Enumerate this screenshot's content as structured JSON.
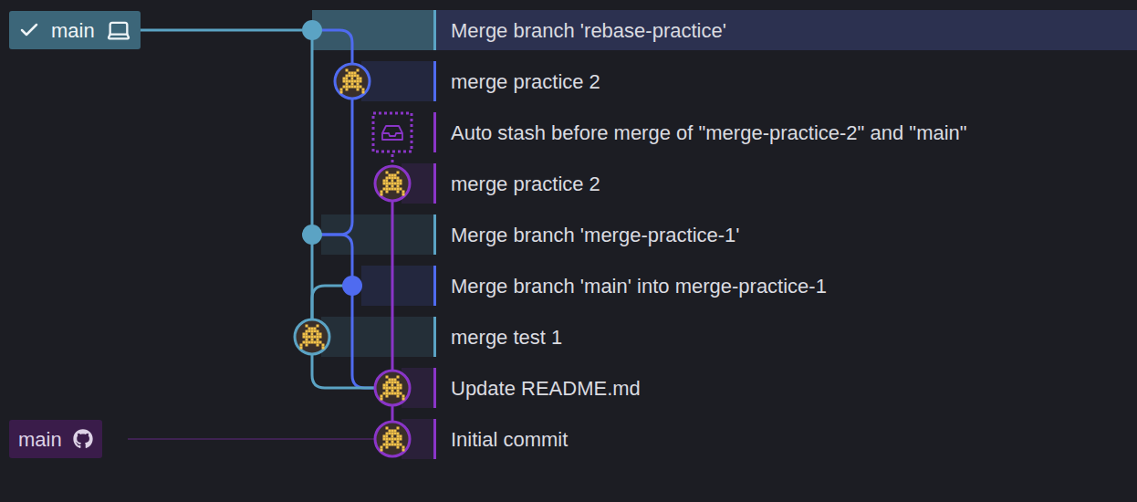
{
  "branches": [
    {
      "name": "main",
      "kind": "local",
      "checked": true,
      "commit": 0,
      "color": "#5ba3c4"
    },
    {
      "name": "main",
      "kind": "remote",
      "checked": false,
      "commit": 8,
      "color": "#4a2563"
    }
  ],
  "commits": [
    {
      "message": "Merge branch 'rebase-practice'",
      "kind": "merge",
      "lane": 0,
      "color": "#5ba3c4",
      "parents": [
        4,
        1
      ],
      "selected": true
    },
    {
      "message": "merge practice 2",
      "kind": "commit",
      "lane": 1,
      "color": "#4f6bf0",
      "parents": [
        4
      ],
      "selected": false
    },
    {
      "message": "Auto stash before merge of \"merge-practice-2\" and \"main\"",
      "kind": "stash",
      "lane": 2,
      "color": "#8a35c8",
      "parents": [
        3
      ],
      "selected": false
    },
    {
      "message": "merge practice 2",
      "kind": "commit",
      "lane": 2,
      "color": "#8a35c8",
      "parents": [
        7
      ],
      "selected": false
    },
    {
      "message": "Merge branch 'merge-practice-1'",
      "kind": "merge",
      "lane": 0,
      "color": "#5ba3c4",
      "parents": [
        6,
        5
      ],
      "selected": false
    },
    {
      "message": "Merge branch 'main' into merge-practice-1",
      "kind": "merge",
      "lane": 1,
      "color": "#4f6bf0",
      "parents": [
        7,
        6
      ],
      "selected": false
    },
    {
      "message": "merge test 1",
      "kind": "commit",
      "lane": 0,
      "color": "#5ba3c4",
      "parents": [
        7
      ],
      "selected": false
    },
    {
      "message": "Update README.md",
      "kind": "commit",
      "lane": 2,
      "color": "#8a35c8",
      "parents": [
        8
      ],
      "selected": false
    },
    {
      "message": "Initial commit",
      "kind": "commit",
      "lane": 2,
      "color": "#8a35c8",
      "parents": [],
      "selected": false
    }
  ]
}
